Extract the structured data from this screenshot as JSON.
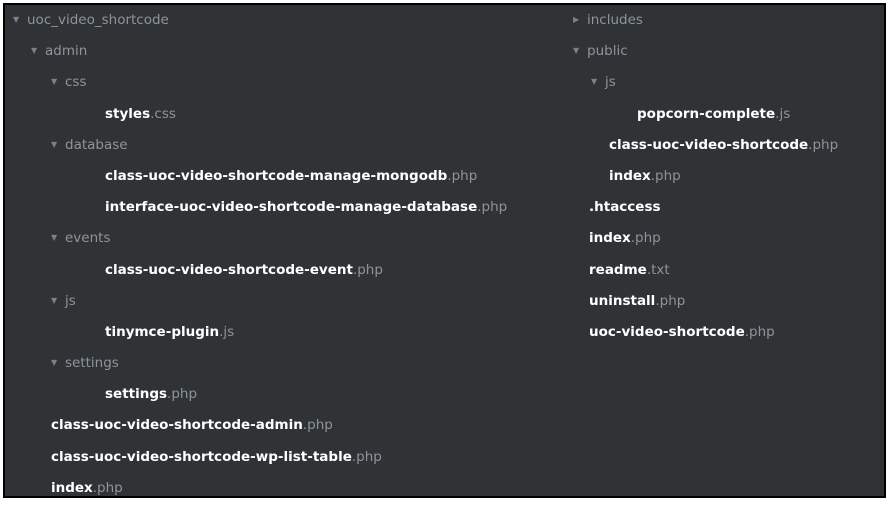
{
  "left_tree": {
    "root": "uoc_video_shortcode",
    "admin": "admin",
    "css": "css",
    "styles": {
      "base": "styles",
      "ext": ".css"
    },
    "database": "database",
    "mongodb": {
      "base": "class-uoc-video-shortcode-manage-mongodb",
      "ext": ".php"
    },
    "manage_db": {
      "base": "interface-uoc-video-shortcode-manage-database",
      "ext": ".php"
    },
    "events": "events",
    "event": {
      "base": "class-uoc-video-shortcode-event",
      "ext": ".php"
    },
    "js": "js",
    "tinymce": {
      "base": "tinymce-plugin",
      "ext": ".js"
    },
    "settings": "settings",
    "settings_file": {
      "base": "settings",
      "ext": ".php"
    },
    "admin_class": {
      "base": "class-uoc-video-shortcode-admin",
      "ext": ".php"
    },
    "wp_list": {
      "base": "class-uoc-video-shortcode-wp-list-table",
      "ext": ".php"
    },
    "admin_index": {
      "base": "index",
      "ext": ".php"
    }
  },
  "right_tree": {
    "includes": "includes",
    "public": "public",
    "js": "js",
    "popcorn": {
      "base": "popcorn-complete",
      "ext": ".js"
    },
    "public_class": {
      "base": "class-uoc-video-shortcode",
      "ext": ".php"
    },
    "public_index": {
      "base": "index",
      "ext": ".php"
    },
    "htaccess": {
      "base": ".htaccess",
      "ext": ""
    },
    "index": {
      "base": "index",
      "ext": ".php"
    },
    "readme": {
      "base": "readme",
      "ext": ".txt"
    },
    "uninstall": {
      "base": "uninstall",
      "ext": ".php"
    },
    "main": {
      "base": "uoc-video-shortcode",
      "ext": ".php"
    }
  },
  "icons": {
    "expanded": "▼",
    "collapsed": "▶"
  },
  "colors": {
    "panel_bg": "#2f3336",
    "folder_text": "#8e9499",
    "file_text": "#ffffff",
    "ext_text": "#8e9499"
  }
}
